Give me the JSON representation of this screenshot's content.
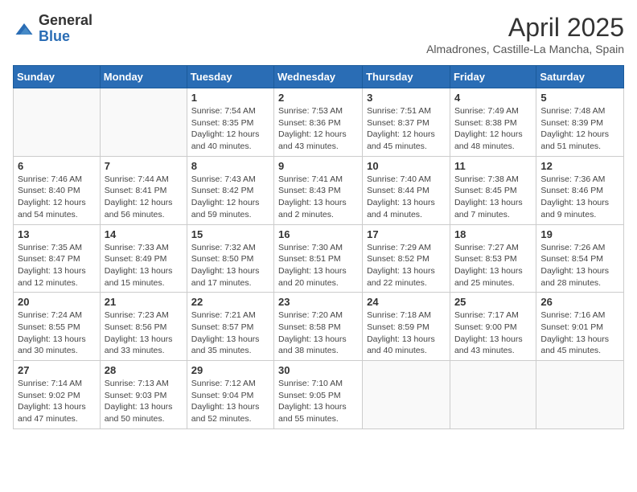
{
  "logo": {
    "general": "General",
    "blue": "Blue"
  },
  "title": "April 2025",
  "location": "Almadrones, Castille-La Mancha, Spain",
  "weekdays": [
    "Sunday",
    "Monday",
    "Tuesday",
    "Wednesday",
    "Thursday",
    "Friday",
    "Saturday"
  ],
  "weeks": [
    [
      {
        "day": "",
        "info": ""
      },
      {
        "day": "",
        "info": ""
      },
      {
        "day": "1",
        "info": "Sunrise: 7:54 AM\nSunset: 8:35 PM\nDaylight: 12 hours and 40 minutes."
      },
      {
        "day": "2",
        "info": "Sunrise: 7:53 AM\nSunset: 8:36 PM\nDaylight: 12 hours and 43 minutes."
      },
      {
        "day": "3",
        "info": "Sunrise: 7:51 AM\nSunset: 8:37 PM\nDaylight: 12 hours and 45 minutes."
      },
      {
        "day": "4",
        "info": "Sunrise: 7:49 AM\nSunset: 8:38 PM\nDaylight: 12 hours and 48 minutes."
      },
      {
        "day": "5",
        "info": "Sunrise: 7:48 AM\nSunset: 8:39 PM\nDaylight: 12 hours and 51 minutes."
      }
    ],
    [
      {
        "day": "6",
        "info": "Sunrise: 7:46 AM\nSunset: 8:40 PM\nDaylight: 12 hours and 54 minutes."
      },
      {
        "day": "7",
        "info": "Sunrise: 7:44 AM\nSunset: 8:41 PM\nDaylight: 12 hours and 56 minutes."
      },
      {
        "day": "8",
        "info": "Sunrise: 7:43 AM\nSunset: 8:42 PM\nDaylight: 12 hours and 59 minutes."
      },
      {
        "day": "9",
        "info": "Sunrise: 7:41 AM\nSunset: 8:43 PM\nDaylight: 13 hours and 2 minutes."
      },
      {
        "day": "10",
        "info": "Sunrise: 7:40 AM\nSunset: 8:44 PM\nDaylight: 13 hours and 4 minutes."
      },
      {
        "day": "11",
        "info": "Sunrise: 7:38 AM\nSunset: 8:45 PM\nDaylight: 13 hours and 7 minutes."
      },
      {
        "day": "12",
        "info": "Sunrise: 7:36 AM\nSunset: 8:46 PM\nDaylight: 13 hours and 9 minutes."
      }
    ],
    [
      {
        "day": "13",
        "info": "Sunrise: 7:35 AM\nSunset: 8:47 PM\nDaylight: 13 hours and 12 minutes."
      },
      {
        "day": "14",
        "info": "Sunrise: 7:33 AM\nSunset: 8:49 PM\nDaylight: 13 hours and 15 minutes."
      },
      {
        "day": "15",
        "info": "Sunrise: 7:32 AM\nSunset: 8:50 PM\nDaylight: 13 hours and 17 minutes."
      },
      {
        "day": "16",
        "info": "Sunrise: 7:30 AM\nSunset: 8:51 PM\nDaylight: 13 hours and 20 minutes."
      },
      {
        "day": "17",
        "info": "Sunrise: 7:29 AM\nSunset: 8:52 PM\nDaylight: 13 hours and 22 minutes."
      },
      {
        "day": "18",
        "info": "Sunrise: 7:27 AM\nSunset: 8:53 PM\nDaylight: 13 hours and 25 minutes."
      },
      {
        "day": "19",
        "info": "Sunrise: 7:26 AM\nSunset: 8:54 PM\nDaylight: 13 hours and 28 minutes."
      }
    ],
    [
      {
        "day": "20",
        "info": "Sunrise: 7:24 AM\nSunset: 8:55 PM\nDaylight: 13 hours and 30 minutes."
      },
      {
        "day": "21",
        "info": "Sunrise: 7:23 AM\nSunset: 8:56 PM\nDaylight: 13 hours and 33 minutes."
      },
      {
        "day": "22",
        "info": "Sunrise: 7:21 AM\nSunset: 8:57 PM\nDaylight: 13 hours and 35 minutes."
      },
      {
        "day": "23",
        "info": "Sunrise: 7:20 AM\nSunset: 8:58 PM\nDaylight: 13 hours and 38 minutes."
      },
      {
        "day": "24",
        "info": "Sunrise: 7:18 AM\nSunset: 8:59 PM\nDaylight: 13 hours and 40 minutes."
      },
      {
        "day": "25",
        "info": "Sunrise: 7:17 AM\nSunset: 9:00 PM\nDaylight: 13 hours and 43 minutes."
      },
      {
        "day": "26",
        "info": "Sunrise: 7:16 AM\nSunset: 9:01 PM\nDaylight: 13 hours and 45 minutes."
      }
    ],
    [
      {
        "day": "27",
        "info": "Sunrise: 7:14 AM\nSunset: 9:02 PM\nDaylight: 13 hours and 47 minutes."
      },
      {
        "day": "28",
        "info": "Sunrise: 7:13 AM\nSunset: 9:03 PM\nDaylight: 13 hours and 50 minutes."
      },
      {
        "day": "29",
        "info": "Sunrise: 7:12 AM\nSunset: 9:04 PM\nDaylight: 13 hours and 52 minutes."
      },
      {
        "day": "30",
        "info": "Sunrise: 7:10 AM\nSunset: 9:05 PM\nDaylight: 13 hours and 55 minutes."
      },
      {
        "day": "",
        "info": ""
      },
      {
        "day": "",
        "info": ""
      },
      {
        "day": "",
        "info": ""
      }
    ]
  ]
}
